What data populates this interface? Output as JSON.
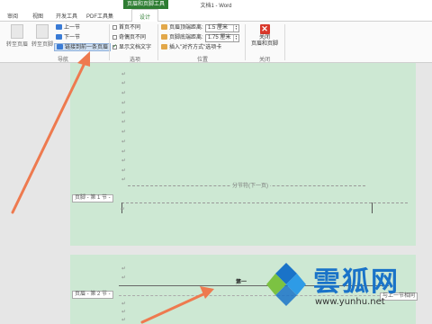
{
  "window": {
    "title": "文档1 - Word",
    "context_tab_group": "页眉和页脚工具"
  },
  "tabs": [
    "审阅",
    "视图",
    "开发工具",
    "PDF工具集"
  ],
  "active_tab": "设计",
  "ribbon": {
    "nav_group": {
      "goto_header": "转至页眉",
      "goto_footer": "转至页脚",
      "prev_section": "上一节",
      "next_section": "下一节",
      "link_to_previous": "链接到前一条页眉",
      "label": "导航"
    },
    "options_group": {
      "different_first_page": "首页不同",
      "different_odd_even": "奇偶页不同",
      "show_document_text": "显示文档文字",
      "label": "选项"
    },
    "position_group": {
      "header_from_top": "页眉顶端距离:",
      "header_value": "1.5 厘米",
      "footer_from_bottom": "页脚底端距离:",
      "footer_value": "1.75 厘米",
      "insert_align_tab": "插入\"对齐方式\"选项卡",
      "label": "位置"
    },
    "close_group": {
      "close_line1": "关闭",
      "close_line2": "页眉和页脚",
      "label": "关闭"
    }
  },
  "document": {
    "para_mark": "↵",
    "section_break": "分节符(下一页)",
    "footer_tag": "页脚 - 第 1 节 -",
    "header_tag": "页眉 - 第 2 节 -",
    "header_text": "第一",
    "same_as_previous": "与上一节相同"
  },
  "watermark": {
    "name": "雲狐网",
    "url": "www.yunhu.net"
  },
  "colors": {
    "context_green": "#2e7d32",
    "page_green": "#cde8d3",
    "arrow_orange": "#ee7a4f",
    "close_red": "#d9382b",
    "watermark_blue": "#1a73c8"
  }
}
